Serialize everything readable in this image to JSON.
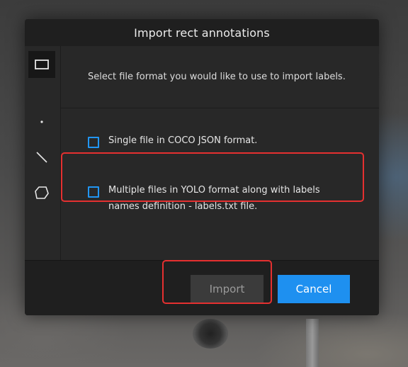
{
  "modal": {
    "title": "Import rect annotations",
    "prompt": "Select file format you would like to use to import labels."
  },
  "sidebar": {
    "tools": [
      {
        "name": "rect",
        "icon": "rectangle-icon",
        "active": true
      },
      {
        "name": "point",
        "icon": "point-icon",
        "active": false
      },
      {
        "name": "line",
        "icon": "line-icon",
        "active": false
      },
      {
        "name": "polygon",
        "icon": "polygon-icon",
        "active": false
      }
    ]
  },
  "options": [
    {
      "label": "Single file in COCO JSON format.",
      "checked": false
    },
    {
      "label": "Multiple files in YOLO format along with labels names definition - labels.txt file.",
      "checked": false
    }
  ],
  "buttons": {
    "import": {
      "label": "Import",
      "disabled": true
    },
    "cancel": {
      "label": "Cancel"
    }
  },
  "colors": {
    "accent": "#1e90f0",
    "checkbox_border": "#2196f3",
    "highlight": "#e53030",
    "modal_bg": "#282828",
    "header_bg": "#1f1f1f"
  }
}
